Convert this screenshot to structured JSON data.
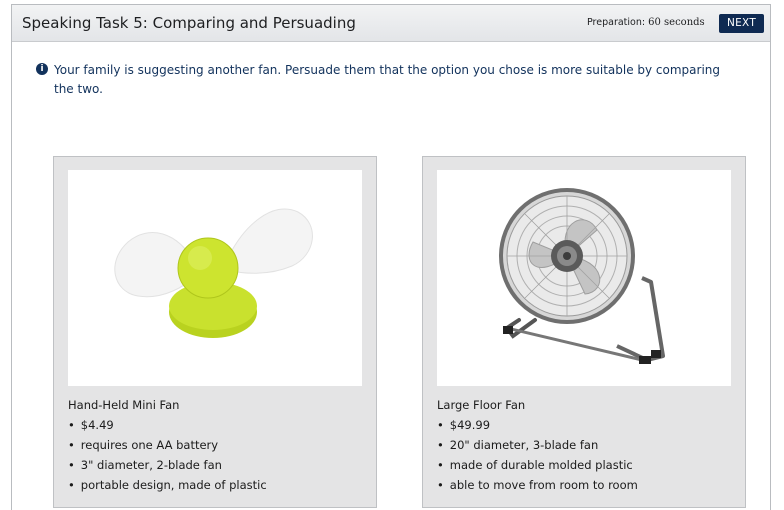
{
  "header": {
    "title": "Speaking Task 5: Comparing and Persuading",
    "prep_label": "Preparation:",
    "prep_value": "60 seconds",
    "next_label": "NEXT"
  },
  "instruction": {
    "icon": "info-icon",
    "text": "Your family is suggesting another fan. Persuade them that the option you chose is more suitable by comparing the two."
  },
  "options": [
    {
      "name": "Hand-Held Mini Fan",
      "image": "hand-held-mini-fan-image",
      "features": [
        "$4.49",
        "requires one AA battery",
        "3\" diameter, 2-blade fan",
        "portable design, made of plastic"
      ]
    },
    {
      "name": "Large Floor Fan",
      "image": "large-floor-fan-image",
      "features": [
        "$49.99",
        "20\" diameter, 3-blade fan",
        "made of durable molded plastic",
        "able to move from room to room"
      ]
    }
  ],
  "colors": {
    "header_bg": "#e6e8eb",
    "accent": "#0f2a52",
    "instruction_text": "#12325c",
    "card_bg": "#e4e4e5",
    "mini_fan_body": "#c6e02a"
  }
}
